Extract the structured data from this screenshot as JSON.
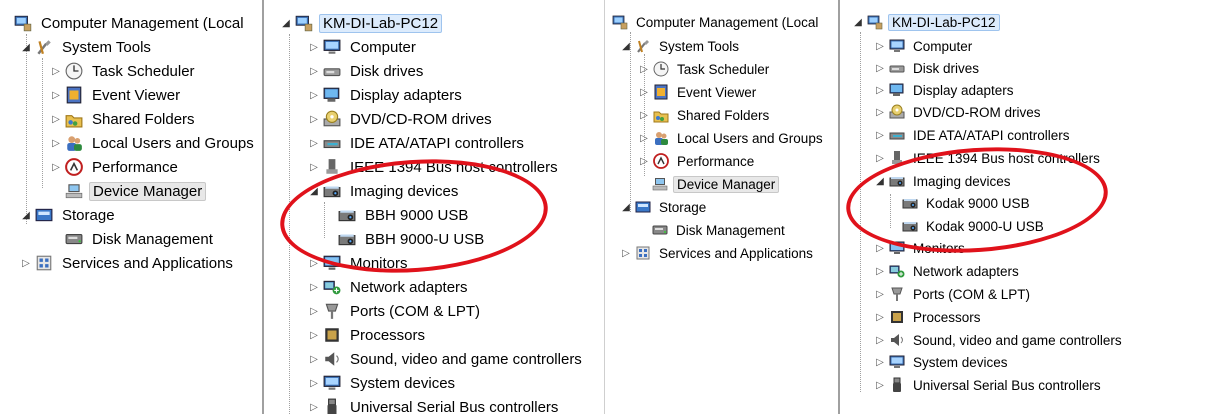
{
  "left_console": {
    "root": "Computer Management (Local",
    "system_tools": "System Tools",
    "task_scheduler": "Task Scheduler",
    "event_viewer": "Event Viewer",
    "shared_folders": "Shared Folders",
    "local_users": "Local Users and Groups",
    "performance": "Performance",
    "device_manager": "Device Manager",
    "storage": "Storage",
    "disk_management": "Disk Management",
    "services": "Services and Applications"
  },
  "left_devices": {
    "root": "KM-DI-Lab-PC12",
    "computer": "Computer",
    "disk_drives": "Disk drives",
    "display_adapters": "Display adapters",
    "dvd": "DVD/CD-ROM drives",
    "ide": "IDE ATA/ATAPI controllers",
    "ieee": "IEEE 1394 Bus host controllers",
    "imaging": "Imaging devices",
    "scanner1": "BBH 9000 USB",
    "scanner2": "BBH 9000-U USB",
    "monitors": "Monitors",
    "network": "Network adapters",
    "ports": "Ports (COM & LPT)",
    "processors": "Processors",
    "sound": "Sound, video and game controllers",
    "system_devices": "System devices",
    "usb": "Universal Serial Bus controllers"
  },
  "right_console": {
    "root": "Computer Management (Local",
    "system_tools": "System Tools",
    "task_scheduler": "Task Scheduler",
    "event_viewer": "Event Viewer",
    "shared_folders": "Shared Folders",
    "local_users": "Local Users and Groups",
    "performance": "Performance",
    "device_manager": "Device Manager",
    "storage": "Storage",
    "disk_management": "Disk Management",
    "services": "Services and Applications"
  },
  "right_devices": {
    "root": "KM-DI-Lab-PC12",
    "computer": "Computer",
    "disk_drives": "Disk drives",
    "display_adapters": "Display adapters",
    "dvd": "DVD/CD-ROM drives",
    "ide": "IDE ATA/ATAPI controllers",
    "ieee": "IEEE 1394 Bus host controllers",
    "imaging": "Imaging devices",
    "scanner1": "Kodak 9000 USB",
    "scanner2": "Kodak 9000-U USB",
    "monitors": "Monitors",
    "network": "Network adapters",
    "ports": "Ports (COM & LPT)",
    "processors": "Processors",
    "sound": "Sound, video and game controllers",
    "system_devices": "System devices",
    "usb": "Universal Serial Bus controllers"
  },
  "colors": {
    "highlight_oval": "#e0121b",
    "selected_root": "#dcebfc"
  }
}
